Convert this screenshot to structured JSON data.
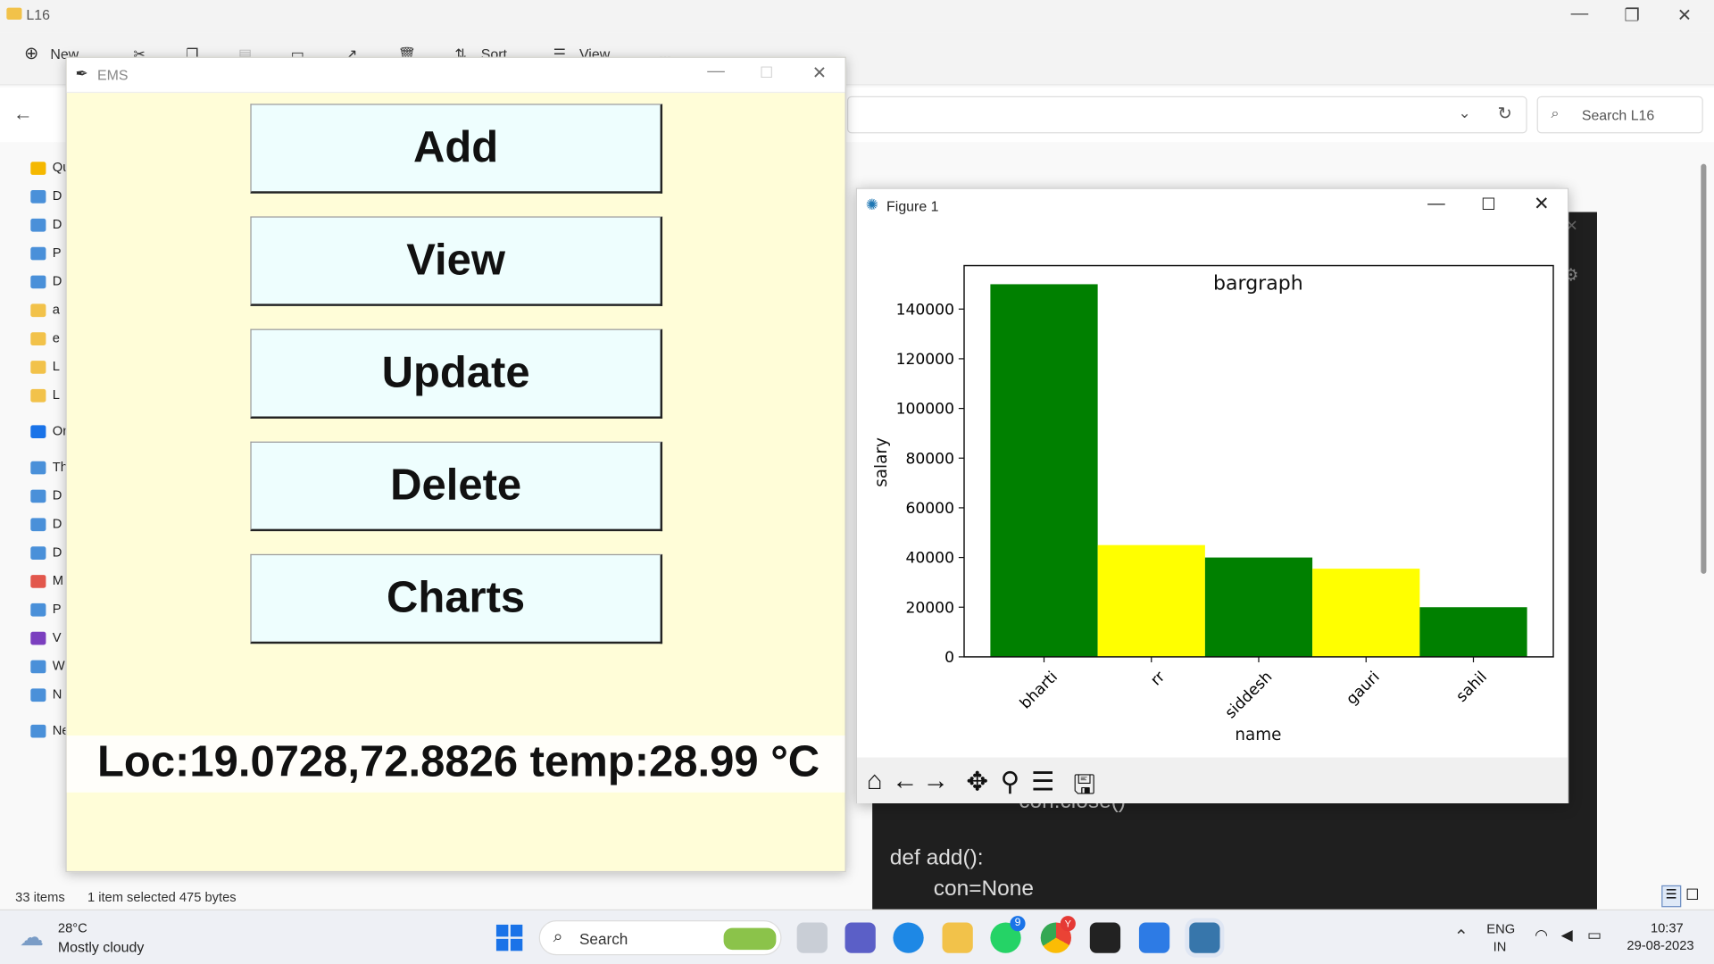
{
  "explorer": {
    "title": "L16",
    "toolbar": {
      "new": "New",
      "sort": "Sort",
      "view": "View",
      "more": "..."
    },
    "search_placeholder": "Search L16",
    "sidebar": [
      {
        "label": "Qu",
        "icon": "star-icon"
      },
      {
        "label": "D",
        "icon": "download-icon"
      },
      {
        "label": "D",
        "icon": "document-icon"
      },
      {
        "label": "P",
        "icon": "picture-icon"
      },
      {
        "label": "D",
        "icon": "desktop-icon"
      },
      {
        "label": "a",
        "icon": "folder-icon"
      },
      {
        "label": "e",
        "icon": "folder-icon"
      },
      {
        "label": "L",
        "icon": "folder-icon"
      },
      {
        "label": "L",
        "icon": "folder-icon"
      },
      {
        "label": "Or",
        "icon": "cloud-icon"
      },
      {
        "label": "Th",
        "icon": "computer-icon"
      },
      {
        "label": "D",
        "icon": "desktop-icon"
      },
      {
        "label": "D",
        "icon": "document-icon"
      },
      {
        "label": "D",
        "icon": "download-icon"
      },
      {
        "label": "M",
        "icon": "music-icon"
      },
      {
        "label": "P",
        "icon": "picture-icon"
      },
      {
        "label": "V",
        "icon": "video-icon"
      },
      {
        "label": "W",
        "icon": "drive-icon"
      },
      {
        "label": "N",
        "icon": "drive-icon"
      },
      {
        "label": "Ne",
        "icon": "network-icon"
      }
    ],
    "status": {
      "items": "33 items",
      "selection": "1 item selected  475 bytes"
    }
  },
  "editor": {
    "lines": [
      "con.close()",
      "def add():",
      "con=None"
    ]
  },
  "ems": {
    "title": "EMS",
    "buttons": [
      "Add",
      "View",
      "Update",
      "Delete",
      "Charts"
    ],
    "status": "Loc:19.0728,72.8826   temp:28.99 °C"
  },
  "figure": {
    "title": "Figure 1",
    "toolbar_icons": [
      "home-icon",
      "back-icon",
      "forward-icon",
      "pan-icon",
      "zoom-icon",
      "configure-icon",
      "save-icon"
    ]
  },
  "chart_data": {
    "type": "bar",
    "title": "bargraph",
    "xlabel": "name",
    "ylabel": "salary",
    "categories": [
      "bharti",
      "rr",
      "siddesh",
      "gauri",
      "sahil"
    ],
    "values": [
      150000,
      45000,
      40000,
      35500,
      20000
    ],
    "colors": [
      "#008000",
      "#ffff00",
      "#008000",
      "#ffff00",
      "#008000"
    ],
    "yticks": [
      0,
      20000,
      40000,
      60000,
      80000,
      100000,
      120000,
      140000
    ],
    "ylim": [
      0,
      157500
    ],
    "grid": false
  },
  "taskbar": {
    "weather": {
      "temp": "28°C",
      "desc": "Mostly cloudy"
    },
    "search": "Search",
    "lang": {
      "line1": "ENG",
      "line2": "IN"
    },
    "clock": {
      "time": "10:37",
      "date": "29-08-2023"
    },
    "whatsapp_badge": "9",
    "chrome_badge": "Y"
  }
}
